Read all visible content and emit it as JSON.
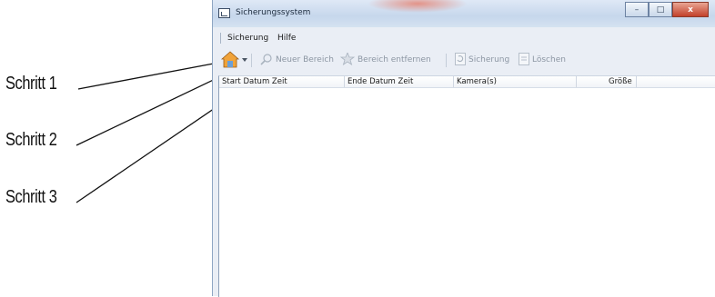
{
  "callouts": [
    "Schritt 1",
    "Schritt 2",
    "Schritt 3"
  ],
  "window": {
    "title": "Sicherungssystem",
    "controls": {
      "minimize": "–",
      "maximize": "□",
      "close": "x"
    }
  },
  "menu": {
    "items": [
      "Sicherung",
      "Hilfe"
    ]
  },
  "toolbar": {
    "items": [
      {
        "label": "Neuer Bereich",
        "icon": "magnifier-icon"
      },
      {
        "label": "Bereich entfernen",
        "icon": "star-icon"
      },
      {
        "label": "Sicherung",
        "icon": "refresh-icon"
      },
      {
        "label": "Löschen",
        "icon": "document-icon"
      }
    ],
    "home_icon": "home-icon"
  },
  "table": {
    "columns": [
      "Start Datum Zeit",
      "Ende Datum Zeit",
      "Kamera(s)",
      "Größe"
    ],
    "rows": []
  }
}
